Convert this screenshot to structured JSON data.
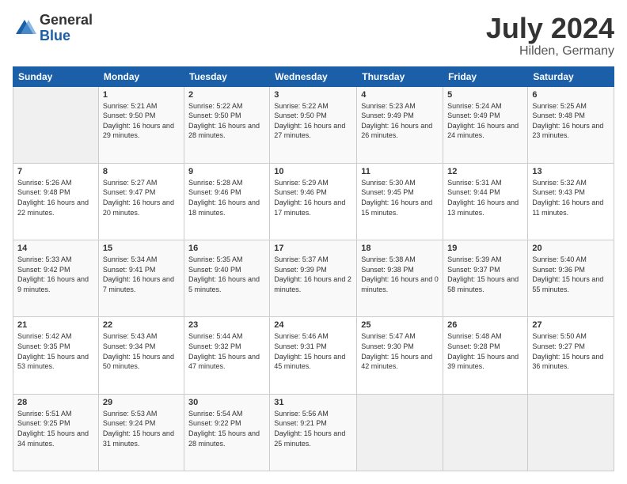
{
  "header": {
    "logo_general": "General",
    "logo_blue": "Blue",
    "month": "July 2024",
    "location": "Hilden, Germany"
  },
  "weekdays": [
    "Sunday",
    "Monday",
    "Tuesday",
    "Wednesday",
    "Thursday",
    "Friday",
    "Saturday"
  ],
  "weeks": [
    [
      {
        "day": "",
        "sunrise": "",
        "sunset": "",
        "daylight": ""
      },
      {
        "day": "1",
        "sunrise": "Sunrise: 5:21 AM",
        "sunset": "Sunset: 9:50 PM",
        "daylight": "Daylight: 16 hours and 29 minutes."
      },
      {
        "day": "2",
        "sunrise": "Sunrise: 5:22 AM",
        "sunset": "Sunset: 9:50 PM",
        "daylight": "Daylight: 16 hours and 28 minutes."
      },
      {
        "day": "3",
        "sunrise": "Sunrise: 5:22 AM",
        "sunset": "Sunset: 9:50 PM",
        "daylight": "Daylight: 16 hours and 27 minutes."
      },
      {
        "day": "4",
        "sunrise": "Sunrise: 5:23 AM",
        "sunset": "Sunset: 9:49 PM",
        "daylight": "Daylight: 16 hours and 26 minutes."
      },
      {
        "day": "5",
        "sunrise": "Sunrise: 5:24 AM",
        "sunset": "Sunset: 9:49 PM",
        "daylight": "Daylight: 16 hours and 24 minutes."
      },
      {
        "day": "6",
        "sunrise": "Sunrise: 5:25 AM",
        "sunset": "Sunset: 9:48 PM",
        "daylight": "Daylight: 16 hours and 23 minutes."
      }
    ],
    [
      {
        "day": "7",
        "sunrise": "Sunrise: 5:26 AM",
        "sunset": "Sunset: 9:48 PM",
        "daylight": "Daylight: 16 hours and 22 minutes."
      },
      {
        "day": "8",
        "sunrise": "Sunrise: 5:27 AM",
        "sunset": "Sunset: 9:47 PM",
        "daylight": "Daylight: 16 hours and 20 minutes."
      },
      {
        "day": "9",
        "sunrise": "Sunrise: 5:28 AM",
        "sunset": "Sunset: 9:46 PM",
        "daylight": "Daylight: 16 hours and 18 minutes."
      },
      {
        "day": "10",
        "sunrise": "Sunrise: 5:29 AM",
        "sunset": "Sunset: 9:46 PM",
        "daylight": "Daylight: 16 hours and 17 minutes."
      },
      {
        "day": "11",
        "sunrise": "Sunrise: 5:30 AM",
        "sunset": "Sunset: 9:45 PM",
        "daylight": "Daylight: 16 hours and 15 minutes."
      },
      {
        "day": "12",
        "sunrise": "Sunrise: 5:31 AM",
        "sunset": "Sunset: 9:44 PM",
        "daylight": "Daylight: 16 hours and 13 minutes."
      },
      {
        "day": "13",
        "sunrise": "Sunrise: 5:32 AM",
        "sunset": "Sunset: 9:43 PM",
        "daylight": "Daylight: 16 hours and 11 minutes."
      }
    ],
    [
      {
        "day": "14",
        "sunrise": "Sunrise: 5:33 AM",
        "sunset": "Sunset: 9:42 PM",
        "daylight": "Daylight: 16 hours and 9 minutes."
      },
      {
        "day": "15",
        "sunrise": "Sunrise: 5:34 AM",
        "sunset": "Sunset: 9:41 PM",
        "daylight": "Daylight: 16 hours and 7 minutes."
      },
      {
        "day": "16",
        "sunrise": "Sunrise: 5:35 AM",
        "sunset": "Sunset: 9:40 PM",
        "daylight": "Daylight: 16 hours and 5 minutes."
      },
      {
        "day": "17",
        "sunrise": "Sunrise: 5:37 AM",
        "sunset": "Sunset: 9:39 PM",
        "daylight": "Daylight: 16 hours and 2 minutes."
      },
      {
        "day": "18",
        "sunrise": "Sunrise: 5:38 AM",
        "sunset": "Sunset: 9:38 PM",
        "daylight": "Daylight: 16 hours and 0 minutes."
      },
      {
        "day": "19",
        "sunrise": "Sunrise: 5:39 AM",
        "sunset": "Sunset: 9:37 PM",
        "daylight": "Daylight: 15 hours and 58 minutes."
      },
      {
        "day": "20",
        "sunrise": "Sunrise: 5:40 AM",
        "sunset": "Sunset: 9:36 PM",
        "daylight": "Daylight: 15 hours and 55 minutes."
      }
    ],
    [
      {
        "day": "21",
        "sunrise": "Sunrise: 5:42 AM",
        "sunset": "Sunset: 9:35 PM",
        "daylight": "Daylight: 15 hours and 53 minutes."
      },
      {
        "day": "22",
        "sunrise": "Sunrise: 5:43 AM",
        "sunset": "Sunset: 9:34 PM",
        "daylight": "Daylight: 15 hours and 50 minutes."
      },
      {
        "day": "23",
        "sunrise": "Sunrise: 5:44 AM",
        "sunset": "Sunset: 9:32 PM",
        "daylight": "Daylight: 15 hours and 47 minutes."
      },
      {
        "day": "24",
        "sunrise": "Sunrise: 5:46 AM",
        "sunset": "Sunset: 9:31 PM",
        "daylight": "Daylight: 15 hours and 45 minutes."
      },
      {
        "day": "25",
        "sunrise": "Sunrise: 5:47 AM",
        "sunset": "Sunset: 9:30 PM",
        "daylight": "Daylight: 15 hours and 42 minutes."
      },
      {
        "day": "26",
        "sunrise": "Sunrise: 5:48 AM",
        "sunset": "Sunset: 9:28 PM",
        "daylight": "Daylight: 15 hours and 39 minutes."
      },
      {
        "day": "27",
        "sunrise": "Sunrise: 5:50 AM",
        "sunset": "Sunset: 9:27 PM",
        "daylight": "Daylight: 15 hours and 36 minutes."
      }
    ],
    [
      {
        "day": "28",
        "sunrise": "Sunrise: 5:51 AM",
        "sunset": "Sunset: 9:25 PM",
        "daylight": "Daylight: 15 hours and 34 minutes."
      },
      {
        "day": "29",
        "sunrise": "Sunrise: 5:53 AM",
        "sunset": "Sunset: 9:24 PM",
        "daylight": "Daylight: 15 hours and 31 minutes."
      },
      {
        "day": "30",
        "sunrise": "Sunrise: 5:54 AM",
        "sunset": "Sunset: 9:22 PM",
        "daylight": "Daylight: 15 hours and 28 minutes."
      },
      {
        "day": "31",
        "sunrise": "Sunrise: 5:56 AM",
        "sunset": "Sunset: 9:21 PM",
        "daylight": "Daylight: 15 hours and 25 minutes."
      },
      {
        "day": "",
        "sunrise": "",
        "sunset": "",
        "daylight": ""
      },
      {
        "day": "",
        "sunrise": "",
        "sunset": "",
        "daylight": ""
      },
      {
        "day": "",
        "sunrise": "",
        "sunset": "",
        "daylight": ""
      }
    ]
  ]
}
